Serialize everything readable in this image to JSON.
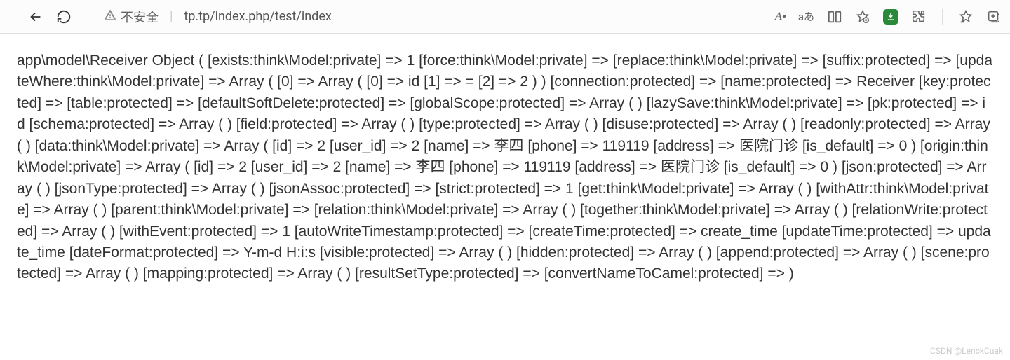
{
  "toolbar": {
    "insecure_label": "不安全",
    "url": "tp.tp/index.php/test/index",
    "text_size_label": "A",
    "text_size_small": "A",
    "lang_label": "aあ"
  },
  "dump": {
    "text": "app\\model\\Receiver Object ( [exists:think\\Model:private] => 1 [force:think\\Model:private] => [replace:think\\Model:private] => [suffix:protected] => [updateWhere:think\\Model:private] => Array ( [0] => Array ( [0] => id [1] => = [2] => 2 ) ) [connection:protected] => [name:protected] => Receiver [key:protected] => [table:protected] => [defaultSoftDelete:protected] => [globalScope:protected] => Array ( ) [lazySave:think\\Model:private] => [pk:protected] => id [schema:protected] => Array ( ) [field:protected] => Array ( ) [type:protected] => Array ( ) [disuse:protected] => Array ( ) [readonly:protected] => Array ( ) [data:think\\Model:private] => Array ( [id] => 2 [user_id] => 2 [name] => 李四 [phone] => 119119 [address] => 医院门诊 [is_default] => 0 ) [origin:think\\Model:private] => Array ( [id] => 2 [user_id] => 2 [name] => 李四 [phone] => 119119 [address] => 医院门诊 [is_default] => 0 ) [json:protected] => Array ( ) [jsonType:protected] => Array ( ) [jsonAssoc:protected] => [strict:protected] => 1 [get:think\\Model:private] => Array ( ) [withAttr:think\\Model:private] => Array ( ) [parent:think\\Model:private] => [relation:think\\Model:private] => Array ( ) [together:think\\Model:private] => Array ( ) [relationWrite:protected] => Array ( ) [withEvent:protected] => 1 [autoWriteTimestamp:protected] => [createTime:protected] => create_time [updateTime:protected] => update_time [dateFormat:protected] => Y-m-d H:i:s [visible:protected] => Array ( ) [hidden:protected] => Array ( ) [append:protected] => Array ( ) [scene:protected] => Array ( ) [mapping:protected] => Array ( ) [resultSetType:protected] => [convertNameToCamel:protected] => )"
  },
  "watermark": "CSDN @LenckCuak"
}
